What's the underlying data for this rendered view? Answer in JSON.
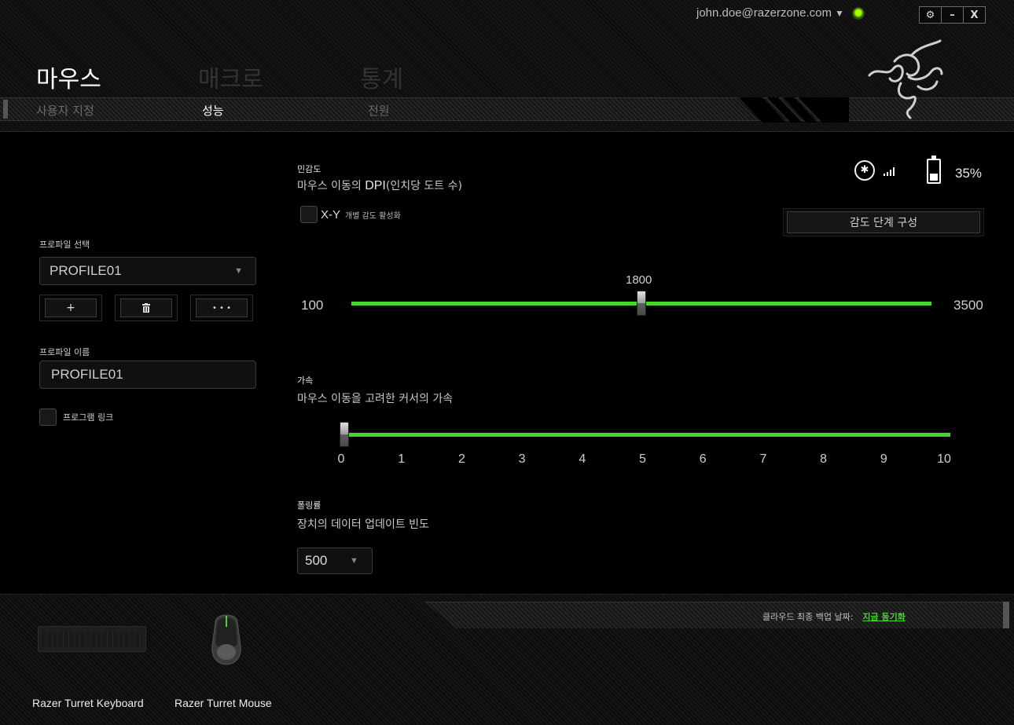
{
  "user": {
    "email": "john.doe@razerzone.com"
  },
  "window_controls": {
    "settings": "⚙",
    "minimize": "–",
    "close": "X"
  },
  "main_tabs": [
    "마우스",
    "매크로",
    "통계"
  ],
  "sub_tabs": [
    "사용자 지정",
    "성능",
    "전원"
  ],
  "active_main_tab": "마우스",
  "active_sub_tab": "성능",
  "left_panel": {
    "profile_select_label": "프로파일 선택",
    "profile_selected": "PROFILE01",
    "buttons": {
      "add": "+",
      "delete": "🗑",
      "more": "• • •"
    },
    "profile_name_label": "프로파일 이름",
    "profile_name_value": "PROFILE01",
    "program_link_label": "프로그램 링크",
    "program_link_checked": false
  },
  "sensitivity": {
    "title": "민감도",
    "subtitle_prefix": "마우스 이동의 ",
    "subtitle_dpi": "DPI",
    "subtitle_suffix": "(인치당 도트 수)",
    "xy_label": "X-Y",
    "xy_sub": "개별 감도 활성화",
    "xy_checked": false,
    "stage_button": "감도 단계 구성",
    "min": "100",
    "max": "3500",
    "value": "1800",
    "min_num": 100,
    "max_num": 3500,
    "value_num": 1800
  },
  "device_status": {
    "bluetooth_icon": "bluetooth-icon",
    "signal_icon": "signal-bars-icon",
    "battery_icon": "battery-icon",
    "battery": "35%",
    "battery_level": 0.35
  },
  "acceleration": {
    "title": "가속",
    "subtitle": "마우스 이동을 고려한 커서의 가속",
    "ticks": [
      "0",
      "1",
      "2",
      "3",
      "4",
      "5",
      "6",
      "7",
      "8",
      "9",
      "10"
    ],
    "value": 0
  },
  "polling": {
    "title": "폴링률",
    "subtitle": "장치의 데이터 업데이트 빈도",
    "value": "500"
  },
  "footer": {
    "backup_label": "클라우드 최종 백업 날짜:",
    "sync_link": "지금 동기화",
    "devices": [
      "Razer Turret Keyboard",
      "Razer Turret Mouse"
    ]
  },
  "colors": {
    "accent": "#44d62c",
    "background": "#000000"
  }
}
